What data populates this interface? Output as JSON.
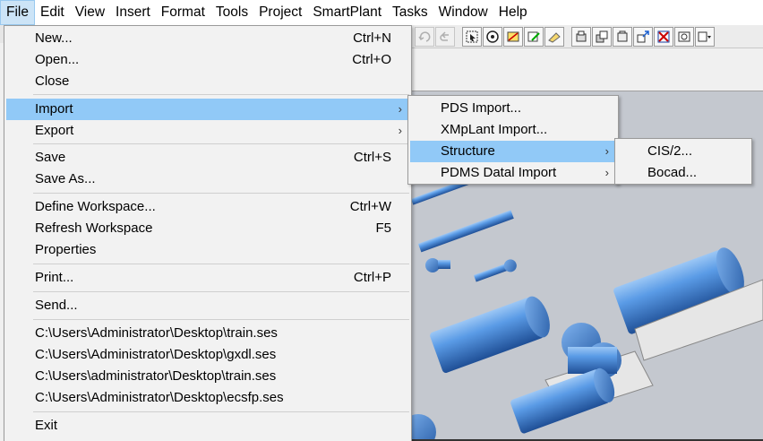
{
  "menubar": {
    "items": [
      "File",
      "Edit",
      "View",
      "Insert",
      "Format",
      "Tools",
      "Project",
      "SmartPlant",
      "Tasks",
      "Window",
      "Help"
    ]
  },
  "file_menu": {
    "items": [
      {
        "label": "New...",
        "shortcut": "Ctrl+N"
      },
      {
        "label": "Open...",
        "shortcut": "Ctrl+O"
      },
      {
        "label": "Close",
        "shortcut": ""
      },
      {
        "label": "Import",
        "shortcut": "",
        "arrow": "›"
      },
      {
        "label": "Export",
        "shortcut": "",
        "arrow": "›"
      },
      {
        "label": "Save",
        "shortcut": "Ctrl+S"
      },
      {
        "label": "Save As...",
        "shortcut": ""
      },
      {
        "label": "Define Workspace...",
        "shortcut": "Ctrl+W"
      },
      {
        "label": "Refresh Workspace",
        "shortcut": "F5"
      },
      {
        "label": "Properties",
        "shortcut": ""
      },
      {
        "label": "Print...",
        "shortcut": "Ctrl+P"
      },
      {
        "label": "Send...",
        "shortcut": ""
      },
      {
        "label": "C:\\Users\\Administrator\\Desktop\\train.ses",
        "shortcut": ""
      },
      {
        "label": "C:\\Users\\Administrator\\Desktop\\gxdl.ses",
        "shortcut": ""
      },
      {
        "label": "C:\\Users\\administrator\\Desktop\\train.ses",
        "shortcut": ""
      },
      {
        "label": "C:\\Users\\Administrator\\Desktop\\ecsfp.ses",
        "shortcut": ""
      },
      {
        "label": "Exit",
        "shortcut": ""
      }
    ]
  },
  "import_menu": {
    "items": [
      {
        "label": "PDS Import...",
        "arrow": ""
      },
      {
        "label": "XMpLant Import...",
        "arrow": ""
      },
      {
        "label": "Structure",
        "arrow": "›"
      },
      {
        "label": "PDMS Datal Import",
        "arrow": "›"
      }
    ]
  },
  "structure_menu": {
    "items": [
      {
        "label": "CIS/2..."
      },
      {
        "label": "Bocad..."
      }
    ]
  },
  "toolbar": {
    "icons": [
      "redo-icon",
      "undo-icon",
      "select-icon",
      "view-icon",
      "measure-icon",
      "edit-icon",
      "layer-icon",
      "filter-icon",
      "clip-icon",
      "camera-icon",
      "zoom-icon",
      "flag-icon",
      "window-icon",
      "dropdown-icon"
    ]
  },
  "colors": {
    "menu_highlight": "#91c9f7",
    "equipment": "#4a90e2",
    "viewport_bg": "#c4c8cf"
  }
}
